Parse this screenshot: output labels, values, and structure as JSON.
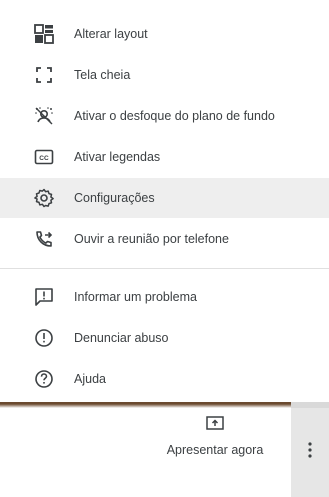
{
  "menu": {
    "items": [
      {
        "label": "Alterar layout",
        "icon": "layout-icon"
      },
      {
        "label": "Tela cheia",
        "icon": "fullscreen-icon"
      },
      {
        "label": "Ativar o desfoque do plano de fundo",
        "icon": "blur-background-icon"
      },
      {
        "label": "Ativar legendas",
        "icon": "captions-icon"
      },
      {
        "label": "Configurações",
        "icon": "gear-icon",
        "highlighted": true
      },
      {
        "label": "Ouvir a reunião por telefone",
        "icon": "phone-forward-icon"
      },
      {
        "label": "Informar um problema",
        "icon": "feedback-icon"
      },
      {
        "label": "Denunciar abuso",
        "icon": "report-icon"
      },
      {
        "label": "Ajuda",
        "icon": "help-icon"
      }
    ]
  },
  "bottom_bar": {
    "present_label": "Apresentar agora",
    "present_icon": "present-screen-icon",
    "more_icon": "more-vert-icon"
  },
  "colors": {
    "text": "#3c4043",
    "highlight": "#eeeeee",
    "divider": "#e0e0e0"
  }
}
